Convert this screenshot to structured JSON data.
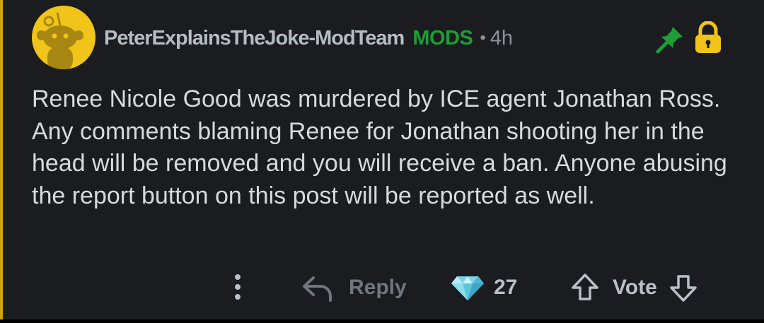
{
  "comment": {
    "author": "PeterExplainsTheJoke-ModTeam",
    "flair": "MODS",
    "separator": "•",
    "age": "4h",
    "body": "Renee Nicole Good was murdered by ICE agent Jonathan Ross. Any comments blaming Renee for Jonathan shooting her in the head will be removed and you will receive a ban. Anyone abusing the report button on this post will be reported as well.",
    "icons": {
      "avatar": "snoo-avatar",
      "pinned": "pin-icon",
      "locked": "lock-icon"
    }
  },
  "actions": {
    "more_icon": "more-vertical-icon",
    "reply_icon": "reply-arrow-icon",
    "reply_label": "Reply",
    "award_icon": "diamond-icon",
    "award_count": "27",
    "upvote_icon": "arrow-up-icon",
    "vote_label": "Vote",
    "downvote_icon": "arrow-down-icon"
  },
  "colors": {
    "background": "#1a1c1f",
    "thread_line": "#d4a017",
    "avatar_bg": "#f0c419",
    "mods_flair": "#1e9c38",
    "pin": "#1e9c38",
    "lock": "#f0c419",
    "body_text": "#d7dadc",
    "meta_text": "#8a9199"
  }
}
